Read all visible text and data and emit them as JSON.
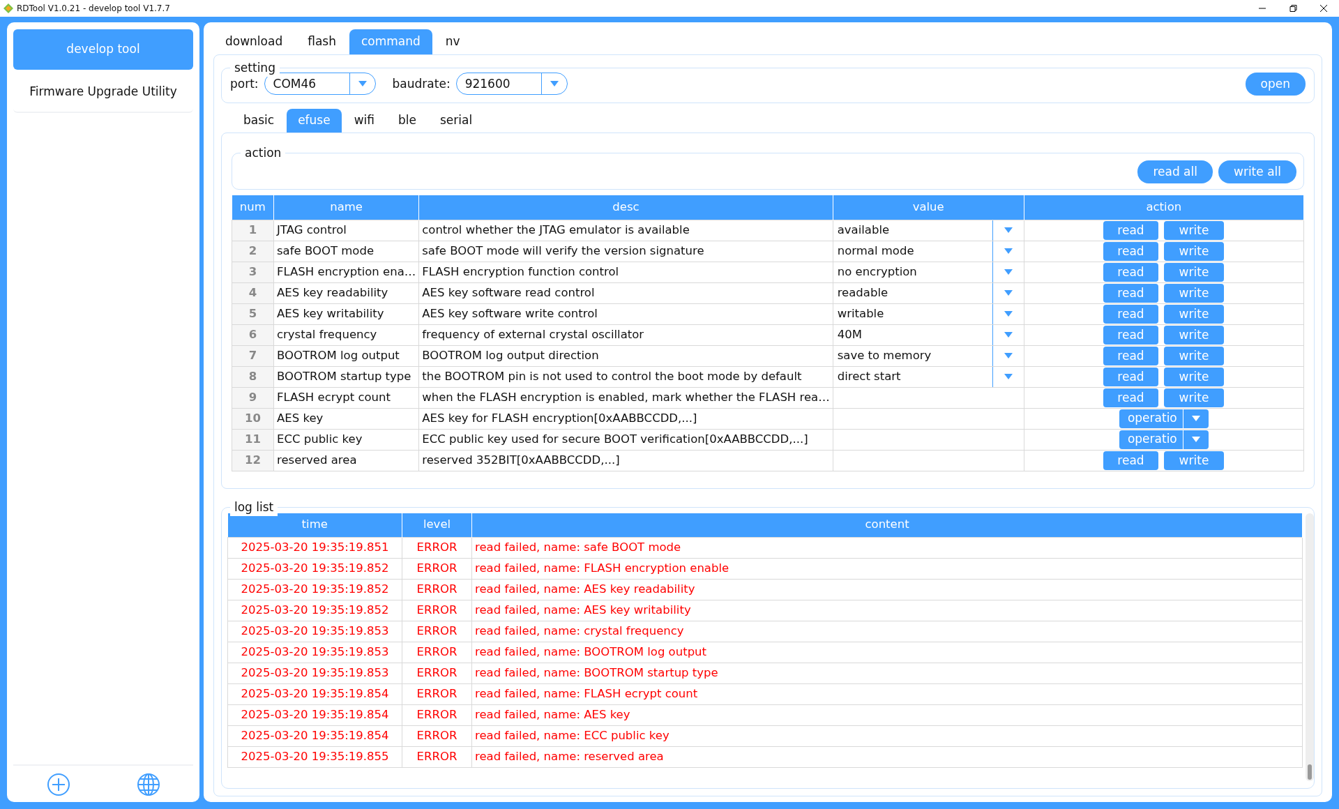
{
  "window": {
    "title": "RDTool V1.0.21 - develop tool V1.7.7"
  },
  "sidebar": {
    "items": [
      {
        "label": "develop tool",
        "selected": true
      },
      {
        "label": "Firmware Upgrade Utility",
        "selected": false
      }
    ]
  },
  "tabs": [
    {
      "label": "download",
      "selected": false
    },
    {
      "label": "flash",
      "selected": false
    },
    {
      "label": "command",
      "selected": true
    },
    {
      "label": "nv",
      "selected": false
    }
  ],
  "setting": {
    "legend": "setting",
    "port": {
      "label": "port:",
      "value": "COM46"
    },
    "baudrate": {
      "label": "baudrate:",
      "value": "921600"
    },
    "open_button": "open"
  },
  "sub_tabs": [
    {
      "label": "basic",
      "selected": false
    },
    {
      "label": "efuse",
      "selected": true
    },
    {
      "label": "wifi",
      "selected": false
    },
    {
      "label": "ble",
      "selected": false
    },
    {
      "label": "serial",
      "selected": false
    }
  ],
  "action": {
    "legend": "action",
    "buttons": [
      "read all",
      "write all"
    ]
  },
  "efuse_table": {
    "columns": [
      "num",
      "name",
      "desc",
      "value",
      "action"
    ],
    "rows": [
      {
        "num": "1",
        "name": "JTAG control",
        "desc": "control whether the JTAG emulator is available",
        "value": "available",
        "kind": "select",
        "actions": [
          "read",
          "write"
        ]
      },
      {
        "num": "2",
        "name": "safe BOOT mode",
        "desc": "safe BOOT mode will verify the version signature",
        "value": "normal mode",
        "kind": "select",
        "actions": [
          "read",
          "write"
        ]
      },
      {
        "num": "3",
        "name": "FLASH encryption ena…",
        "desc": "FLASH encryption function control",
        "value": "no encryption",
        "kind": "select",
        "actions": [
          "read",
          "write"
        ]
      },
      {
        "num": "4",
        "name": "AES key readability",
        "desc": "AES key software read control",
        "value": "readable",
        "kind": "select",
        "actions": [
          "read",
          "write"
        ]
      },
      {
        "num": "5",
        "name": "AES key writability",
        "desc": "AES key software write control",
        "value": "writable",
        "kind": "select",
        "actions": [
          "read",
          "write"
        ]
      },
      {
        "num": "6",
        "name": "crystal frequency",
        "desc": "frequency of external crystal oscillator",
        "value": "40M",
        "kind": "select",
        "actions": [
          "read",
          "write"
        ]
      },
      {
        "num": "7",
        "name": "BOOTROM log output",
        "desc": "BOOTROM log output direction",
        "value": "save to memory",
        "kind": "select",
        "actions": [
          "read",
          "write"
        ]
      },
      {
        "num": "8",
        "name": "BOOTROM startup type",
        "desc": "the BOOTROM pin is not used to control the boot mode by default",
        "value": "direct start",
        "kind": "select",
        "actions": [
          "read",
          "write"
        ]
      },
      {
        "num": "9",
        "name": "FLASH ecrypt count",
        "desc": "when the FLASH encryption is enabled, mark whether the FLASH rea…",
        "kind": "buttons",
        "actions": [
          "read",
          "write"
        ]
      },
      {
        "num": "10",
        "name": "AES key",
        "desc": "AES key for FLASH encryption[0xAABBCCDD,...]",
        "kind": "menu",
        "actions": [
          "operatio"
        ]
      },
      {
        "num": "11",
        "name": "ECC public key",
        "desc": "ECC public key used for secure BOOT verification[0xAABBCCDD,...]",
        "kind": "menu",
        "actions": [
          "operatio"
        ]
      },
      {
        "num": "12",
        "name": "reserved area",
        "desc": "reserved 352BIT[0xAABBCCDD,...]",
        "kind": "buttons",
        "actions": [
          "read",
          "write"
        ]
      }
    ]
  },
  "log": {
    "legend": "log list",
    "columns": [
      "time",
      "level",
      "content"
    ],
    "rows": [
      {
        "time": "2025-03-20 19:35:19.851",
        "level": "ERROR",
        "content": "read failed, name: safe BOOT mode"
      },
      {
        "time": "2025-03-20 19:35:19.852",
        "level": "ERROR",
        "content": "read failed, name: FLASH encryption enable"
      },
      {
        "time": "2025-03-20 19:35:19.852",
        "level": "ERROR",
        "content": "read failed, name: AES key readability"
      },
      {
        "time": "2025-03-20 19:35:19.852",
        "level": "ERROR",
        "content": "read failed, name: AES key writability"
      },
      {
        "time": "2025-03-20 19:35:19.853",
        "level": "ERROR",
        "content": "read failed, name: crystal frequency"
      },
      {
        "time": "2025-03-20 19:35:19.853",
        "level": "ERROR",
        "content": "read failed, name: BOOTROM log output"
      },
      {
        "time": "2025-03-20 19:35:19.853",
        "level": "ERROR",
        "content": "read failed, name: BOOTROM startup type"
      },
      {
        "time": "2025-03-20 19:35:19.854",
        "level": "ERROR",
        "content": "read failed, name: FLASH ecrypt count"
      },
      {
        "time": "2025-03-20 19:35:19.854",
        "level": "ERROR",
        "content": "read failed, name: AES key"
      },
      {
        "time": "2025-03-20 19:35:19.854",
        "level": "ERROR",
        "content": "read failed, name: ECC public key"
      },
      {
        "time": "2025-03-20 19:35:19.855",
        "level": "ERROR",
        "content": "read failed, name: reserved area"
      }
    ]
  }
}
